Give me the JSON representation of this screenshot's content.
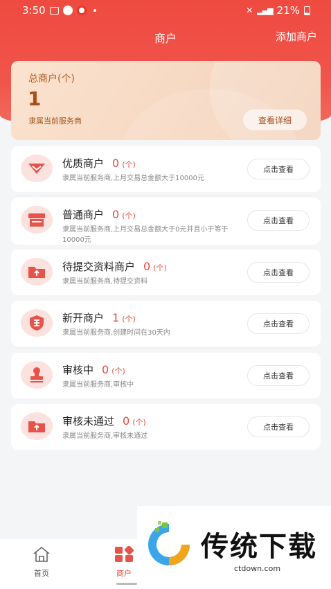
{
  "status_bar": {
    "time": "3:50",
    "battery": "21%"
  },
  "nav": {
    "title": "商户",
    "add_label": "添加商户"
  },
  "summary": {
    "label": "总商户(个)",
    "value": "1",
    "subtitle": "隶属当前服务商",
    "button_label": "查看详细"
  },
  "categories": [
    {
      "title": "优质商户",
      "count": "0",
      "unit": "(个)",
      "desc": "隶属当前服务商,上月交易总金额大于10000元",
      "button": "点击查看",
      "icon": "diamond-icon"
    },
    {
      "title": "普通商户",
      "count": "0",
      "unit": "(个)",
      "desc": "隶属当前服务商,上月交易总金额大于0元并且小于等于10000元",
      "button": "点击查看",
      "icon": "shop-icon"
    },
    {
      "title": "待提交资料商户",
      "count": "0",
      "unit": "(个)",
      "desc": "隶属当前服务商,待提交资料",
      "button": "点击查看",
      "icon": "folder-upload-icon"
    },
    {
      "title": "新开商户",
      "count": "1",
      "unit": "(个)",
      "desc": "隶属当前服务商,创建时间在30天内",
      "button": "点击查看",
      "icon": "shield-icon"
    },
    {
      "title": "审核中",
      "count": "0",
      "unit": "(个)",
      "desc": "隶属当前服务商,审核中",
      "button": "点击查看",
      "icon": "stamp-icon"
    },
    {
      "title": "审核未通过",
      "count": "0",
      "unit": "(个)",
      "desc": "隶属当前服务商,审核未通过",
      "button": "点击查看",
      "icon": "folder-upload-icon"
    }
  ],
  "tabbar": {
    "home_label": "首页",
    "merchant_label": "商户"
  },
  "watermark": {
    "text": "传统下载",
    "url": "ctdown.com"
  },
  "colors": {
    "accent": "#ef4a40",
    "count": "#e24b3b",
    "icon_bg": "#fbe2de"
  }
}
